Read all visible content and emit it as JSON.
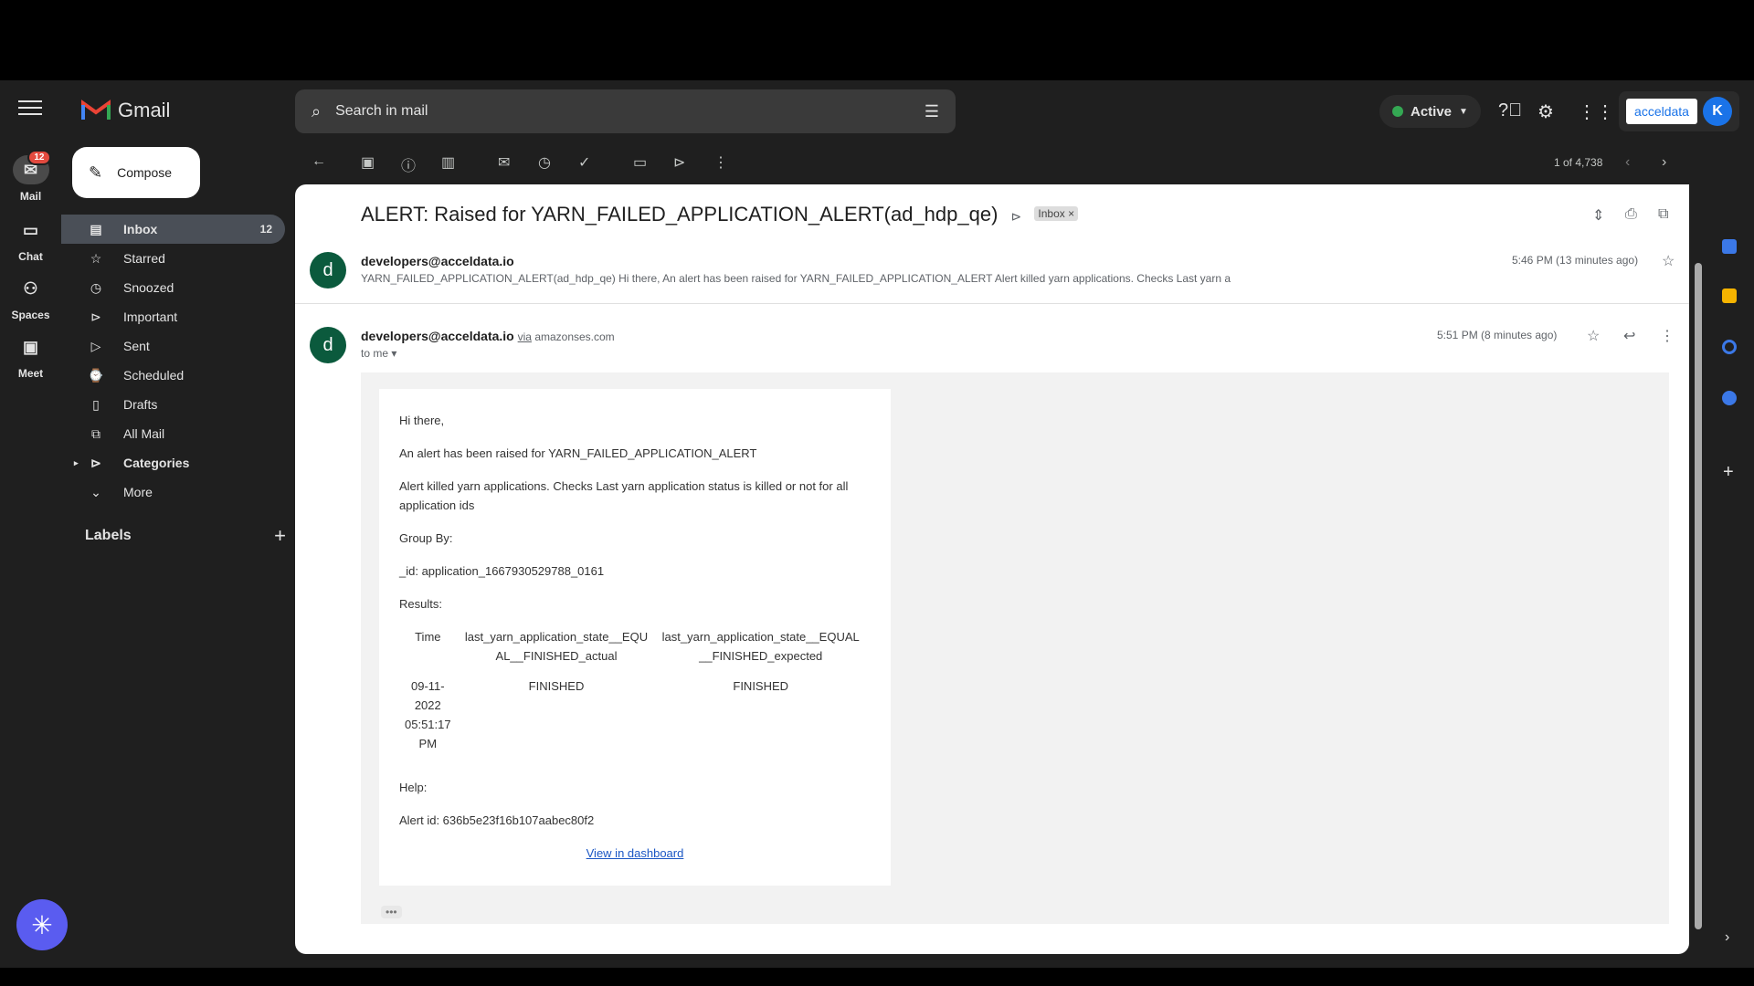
{
  "app": {
    "name": "Gmail"
  },
  "rail": {
    "mail_label": "Mail",
    "mail_badge": "12",
    "chat_label": "Chat",
    "spaces_label": "Spaces",
    "meet_label": "Meet"
  },
  "sidebar": {
    "compose_label": "Compose",
    "items": [
      {
        "label": "Inbox",
        "count": "12",
        "icon": "inbox-icon"
      },
      {
        "label": "Starred",
        "count": "",
        "icon": "star-icon"
      },
      {
        "label": "Snoozed",
        "count": "",
        "icon": "clock-icon"
      },
      {
        "label": "Important",
        "count": "",
        "icon": "important-icon"
      },
      {
        "label": "Sent",
        "count": "",
        "icon": "send-icon"
      },
      {
        "label": "Scheduled",
        "count": "",
        "icon": "scheduled-icon"
      },
      {
        "label": "Drafts",
        "count": "",
        "icon": "draft-icon"
      },
      {
        "label": "All Mail",
        "count": "",
        "icon": "all-mail-icon"
      },
      {
        "label": "Categories",
        "count": "",
        "icon": "label-icon"
      },
      {
        "label": "More",
        "count": "",
        "icon": "chevron-down-icon"
      }
    ],
    "labels_heading": "Labels"
  },
  "search": {
    "placeholder": "Search in mail"
  },
  "status": {
    "label": "Active",
    "color": "#34a853"
  },
  "account": {
    "org_logo_text": "acceldata",
    "avatar_letter": "K"
  },
  "toolbar": {
    "pager": "1 of 4,738"
  },
  "thread": {
    "subject": "ALERT: Raised for YARN_FAILED_APPLICATION_ALERT(ad_hdp_qe)",
    "label_chip": "Inbox",
    "messages": [
      {
        "sender": "developers@acceldata.io",
        "snippet": "YARN_FAILED_APPLICATION_ALERT(ad_hdp_qe) Hi there, An alert has been raised for YARN_FAILED_APPLICATION_ALERT Alert killed yarn applications. Checks Last yarn a",
        "time": "5:46 PM (13 minutes ago)"
      },
      {
        "sender": "developers@acceldata.io",
        "via_word": "via",
        "via_domain": "amazonses.com",
        "to": "to me",
        "time": "5:51 PM (8 minutes ago)"
      }
    ]
  },
  "email_body": {
    "greeting": "Hi there,",
    "line1": "An alert has been raised for YARN_FAILED_APPLICATION_ALERT",
    "line2": "Alert killed yarn applications. Checks Last yarn application status is killed or not for all application ids",
    "group_by": "Group By:",
    "id_line": "_id: application_1667930529788_0161",
    "results_label": "Results:",
    "table": {
      "headers": [
        "Time",
        "last_yarn_application_state__EQUAL__FINISHED_actual",
        "last_yarn_application_state__EQUAL__FINISHED_expected"
      ],
      "rows": [
        [
          "09-11-2022 05:51:17 PM",
          "FINISHED",
          "FINISHED"
        ]
      ]
    },
    "help": "Help:",
    "alert_id": "Alert id: 636b5e23f16b107aabec80f2",
    "dashboard_link": "View in dashboard",
    "more": "•••"
  }
}
